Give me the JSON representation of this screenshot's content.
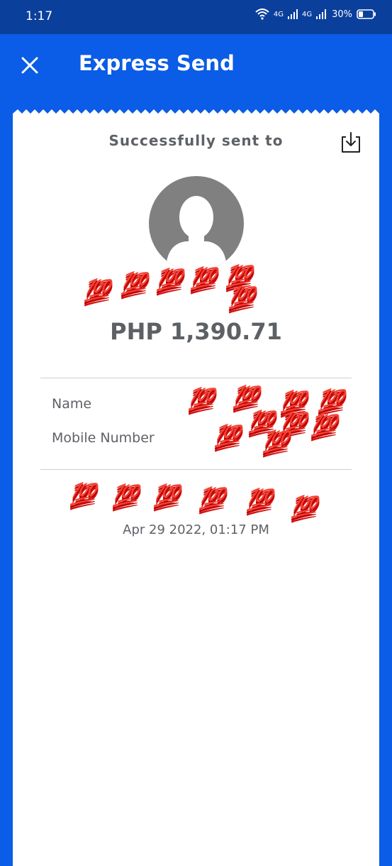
{
  "status_bar": {
    "time": "1:17",
    "network_1": "4G",
    "network_2": "4G",
    "battery": "30%"
  },
  "app_bar": {
    "title": "Express Send",
    "close_icon": "close-icon"
  },
  "receipt": {
    "heading": "Successfully sent to",
    "download_icon": "download-icon",
    "avatar_icon": "avatar-icon",
    "recipient_name": "",
    "amount": "PHP 1,390.71",
    "details": [
      {
        "label": "Name",
        "value": ""
      },
      {
        "label": "Mobile Number",
        "value": ""
      }
    ],
    "ref_no": "",
    "timestamp": "Apr 29 2022, 01:17 PM",
    "redaction_mark": "💯"
  },
  "colors": {
    "brand_blue": "#0b5ce6",
    "status_bar": "#0b3f9c",
    "text_gray": "#5e6166",
    "redaction": "#d41010"
  }
}
